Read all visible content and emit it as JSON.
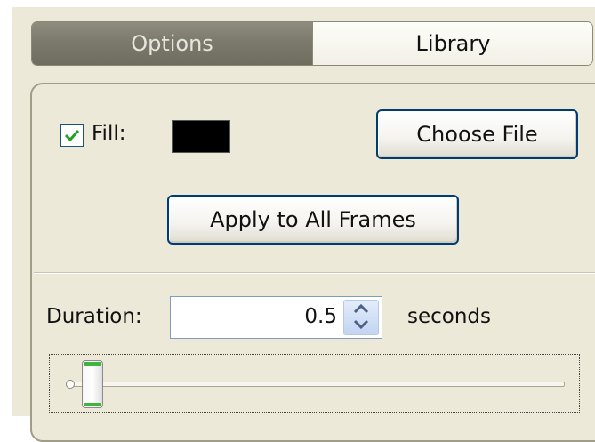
{
  "tabs": [
    {
      "label": "Options",
      "selected": true
    },
    {
      "label": "Library",
      "selected": false
    }
  ],
  "fill": {
    "label": "Fill:",
    "checked": true,
    "color": "#000000"
  },
  "buttons": {
    "choose_file": "Choose File",
    "apply_all": "Apply to All Frames"
  },
  "duration": {
    "label": "Duration:",
    "value": "0.5",
    "unit": "seconds"
  },
  "slider": {
    "level": 0.05
  },
  "colors": {
    "selected_tab": "#7b7a6c",
    "checkmark": "#21a121",
    "panel_bg": "#ece9d8",
    "thumb_accent": "#3fb53f"
  }
}
